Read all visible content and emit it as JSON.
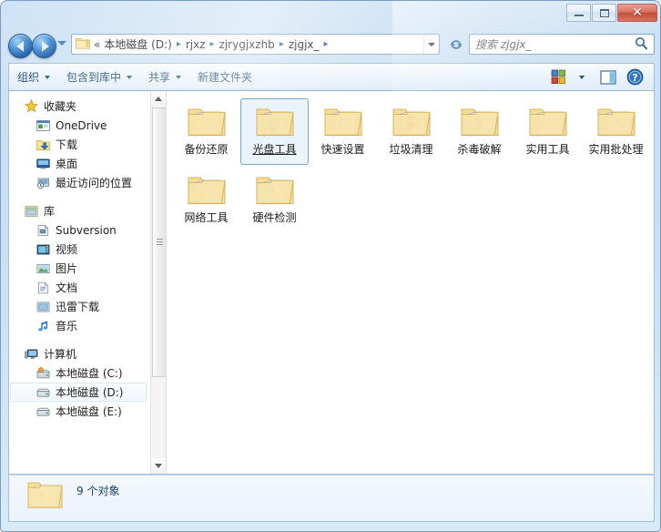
{
  "window": {
    "controls": {
      "minimize": "minimize-button",
      "maximize": "maximize-button",
      "close_label": "✕"
    }
  },
  "nav": {
    "back_tooltip": "后退",
    "forward_tooltip": "前进",
    "history_tooltip": "最近浏览的位置"
  },
  "address": {
    "overflow": "«",
    "crumbs": [
      {
        "label": "本地磁盘 (D:)"
      },
      {
        "label": "rjxz"
      },
      {
        "label": "zjrygjxzhb"
      },
      {
        "label": "zjgjx_"
      }
    ],
    "separator": "▸"
  },
  "search": {
    "placeholder": "搜索 zjgjx_",
    "value": ""
  },
  "toolbar": {
    "items": [
      {
        "label": "组织",
        "has_caret": true
      },
      {
        "label": "包含到库中",
        "has_caret": true
      },
      {
        "label": "共享",
        "has_caret": true
      },
      {
        "label": "新建文件夹",
        "has_caret": false
      }
    ],
    "view_icon": "view-options-icon",
    "view_caret": "chevron-down-icon",
    "preview_icon": "preview-pane-icon",
    "help_icon": "help-icon",
    "help_glyph": "?"
  },
  "sidebar": {
    "groups": [
      {
        "header": "收藏夹",
        "header_icon": "star-icon",
        "items": [
          {
            "label": "OneDrive",
            "icon": "onedrive-icon",
            "selected": false
          },
          {
            "label": "下载",
            "icon": "downloads-icon",
            "selected": false
          },
          {
            "label": "桌面",
            "icon": "desktop-icon",
            "selected": false
          },
          {
            "label": "最近访问的位置",
            "icon": "recent-places-icon",
            "selected": false
          }
        ]
      },
      {
        "header": "库",
        "header_icon": "library-icon",
        "items": [
          {
            "label": "Subversion",
            "icon": "subversion-icon",
            "selected": false
          },
          {
            "label": "视频",
            "icon": "video-icon",
            "selected": false
          },
          {
            "label": "图片",
            "icon": "pictures-icon",
            "selected": false
          },
          {
            "label": "文档",
            "icon": "documents-icon",
            "selected": false
          },
          {
            "label": "迅雷下载",
            "icon": "thunder-download-icon",
            "selected": false
          },
          {
            "label": "音乐",
            "icon": "music-icon",
            "selected": false
          }
        ]
      },
      {
        "header": "计算机",
        "header_icon": "computer-icon",
        "items": [
          {
            "label": "本地磁盘 (C:)",
            "icon": "system-drive-icon",
            "selected": false
          },
          {
            "label": "本地磁盘 (D:)",
            "icon": "drive-icon",
            "selected": true
          },
          {
            "label": "本地磁盘 (E:)",
            "icon": "drive-icon",
            "selected": false
          }
        ]
      }
    ]
  },
  "files": [
    {
      "name": "备份还原",
      "type": "folder",
      "overlay": "globe",
      "selected": false
    },
    {
      "name": "光盘工具",
      "type": "folder",
      "overlay": "disc",
      "selected": true
    },
    {
      "name": "快速设置",
      "type": "folder",
      "overlay": "plain",
      "selected": false
    },
    {
      "name": "垃圾清理",
      "type": "folder",
      "overlay": "shapes",
      "selected": false
    },
    {
      "name": "杀毒破解",
      "type": "folder",
      "overlay": "texture",
      "selected": false
    },
    {
      "name": "实用工具",
      "type": "folder",
      "overlay": "plain",
      "selected": false
    },
    {
      "name": "实用批处理",
      "type": "folder",
      "overlay": "docs",
      "selected": false
    },
    {
      "name": "网络工具",
      "type": "folder",
      "overlay": "plain",
      "selected": false
    },
    {
      "name": "硬件检测",
      "type": "folder",
      "overlay": "plain",
      "selected": false
    }
  ],
  "details": {
    "count_text": "9 个对象",
    "icon": "folder-icon"
  },
  "colors": {
    "accent": "#1a5ba8",
    "glass": "#cadff3",
    "close_button": "#b93d27",
    "selection_fill": "#ebf4fd",
    "selection_border": "#7da2ce",
    "folder_body": "#fbe8a8",
    "folder_edge": "#e6c878",
    "toolbar_text": "#16436e"
  }
}
